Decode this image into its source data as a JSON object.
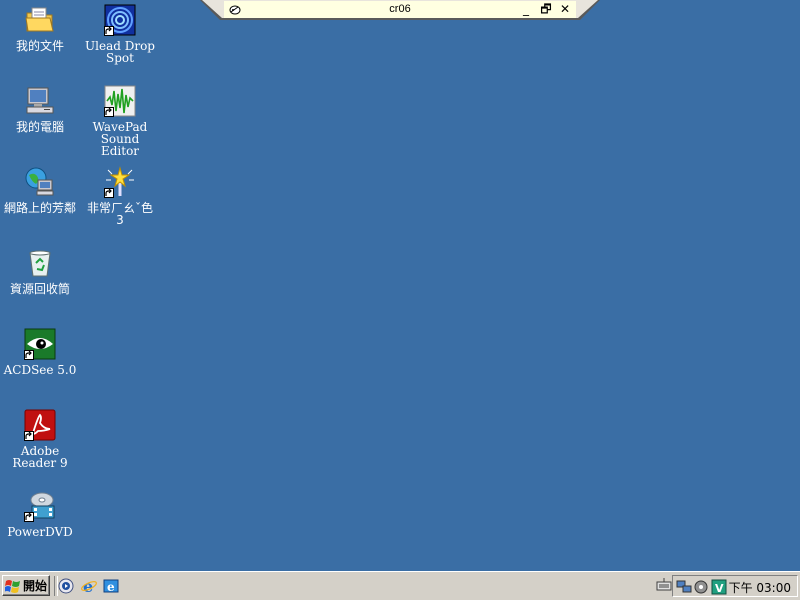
{
  "window": {
    "title": "cr06",
    "minimize": "_",
    "restore": "🗗",
    "close": "✕"
  },
  "desktop_icons": [
    {
      "label": "我的文件",
      "icon": "folder-documents-icon"
    },
    {
      "label": "我的電腦",
      "icon": "computer-icon"
    },
    {
      "label": "網路上的芳鄰",
      "icon": "network-icon"
    },
    {
      "label": "資源回收筒",
      "icon": "recycle-bin-icon"
    },
    {
      "label": "ACDSee 5.0",
      "icon": "acdsee-icon"
    },
    {
      "label": "Adobe Reader 9",
      "icon": "adobe-reader-icon"
    },
    {
      "label": "PowerDVD",
      "icon": "powerdvd-icon"
    },
    {
      "label": "Ulead Drop\nSpot",
      "icon": "ulead-icon"
    },
    {
      "label": "WavePad\nSound Editor",
      "icon": "wavepad-icon"
    },
    {
      "label": "非常ㄏㄠˇ色\n3",
      "icon": "magic-wand-icon"
    }
  ],
  "taskbar": {
    "start_label": "開始",
    "clock": "下午 03:00"
  },
  "colors": {
    "desktop": "#3a6ea5",
    "taskbar": "#d4d0c8",
    "window_bar": "#ffffe1"
  }
}
